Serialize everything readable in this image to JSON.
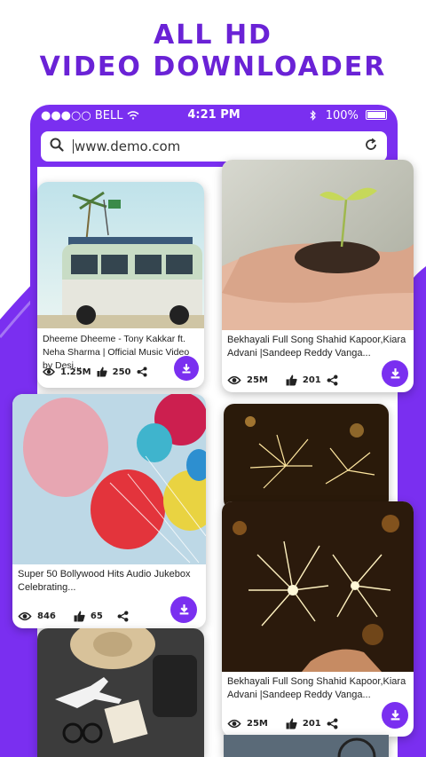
{
  "headline": {
    "line1": "ALL HD",
    "line2": "VIDEO DOWNLOADER"
  },
  "status_bar": {
    "carrier": "●●●○○ BELL",
    "time": "4:21 PM",
    "battery": "100%"
  },
  "browser": {
    "url": "www.demo.com"
  },
  "videos": [
    {
      "title": "Dheeme Dheeme - Tony Kakkar ft. Neha Sharma | Official Music Video by Desi...",
      "views": "1.25M",
      "likes": "250"
    },
    {
      "title": "Bekhayali Full Song Shahid Kapoor,Kiara Advani |Sandeep Reddy Vanga...",
      "views": "25M",
      "likes": "201"
    },
    {
      "title": "Super 50 Bollywood Hits Audio Jukebox Celebrating...",
      "views": "846",
      "likes": "65"
    },
    {
      "title": "Bekhayali Full Song Shahid Kapoor,Kiara Advani |Sandeep Reddy Vanga...",
      "views": "25M",
      "likes": "201"
    }
  ],
  "colors": {
    "brand": "#7a2ff0",
    "headline": "#6a22d6"
  }
}
